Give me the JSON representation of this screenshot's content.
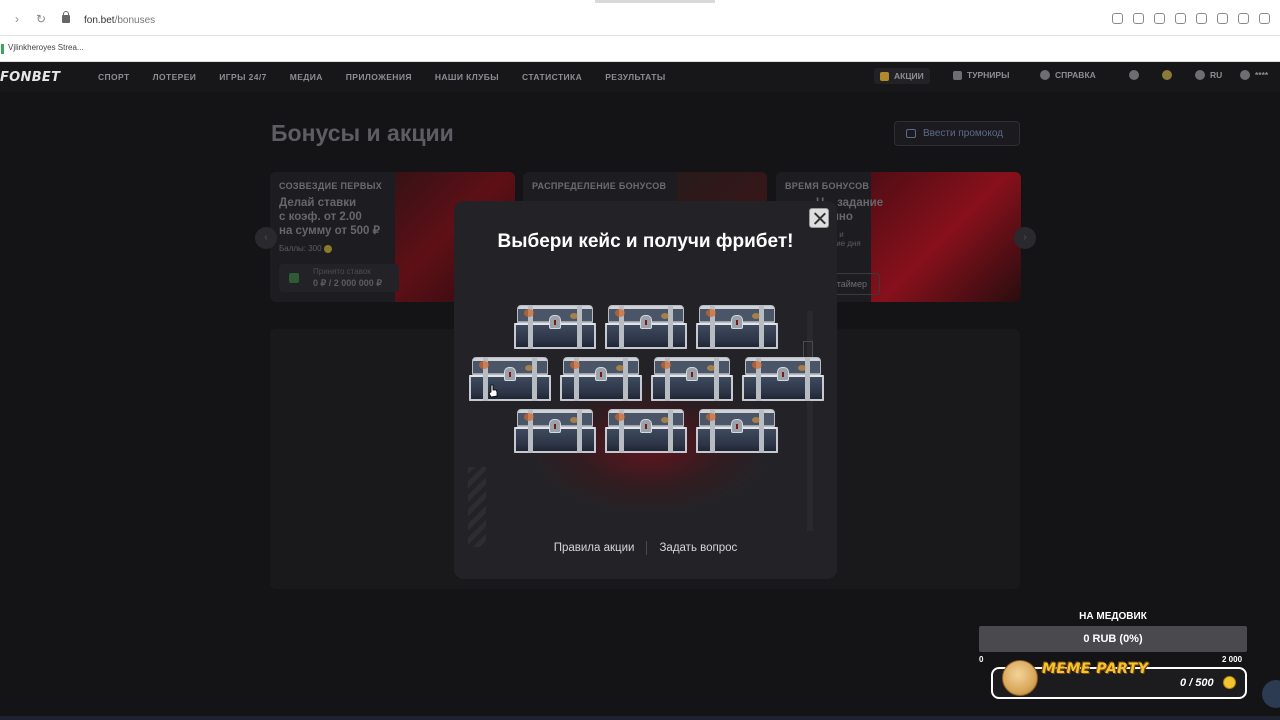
{
  "browser": {
    "url_domain": "fon.bet",
    "url_path": "/bonuses",
    "bookmark": "Vjlinkheroyes Strea..."
  },
  "header": {
    "logo": "FONBET",
    "nav": [
      "СПОРТ",
      "ЛОТЕРЕИ",
      "ИГРЫ 24/7",
      "МЕДИА",
      "ПРИЛОЖЕНИЯ",
      "НАШИ КЛУБЫ",
      "СТАТИСТИКА",
      "РЕЗУЛЬТАТЫ"
    ],
    "promotions": "АКЦИИ",
    "tournaments": "ТУРНИРЫ",
    "help": "СПРАВКА",
    "language": "RU",
    "account": "****"
  },
  "page": {
    "title": "Бонусы и акции",
    "promo_code_button": "Ввести промокод"
  },
  "cards": [
    {
      "label": "СОЗВЕЗДИЕ ПЕРВЫХ",
      "headline": [
        "Делай ставки",
        "с коэф. от 2.00",
        "на сумму от 500 ₽"
      ],
      "points": "Баллы: 300",
      "accepted_label": "Принято ставок",
      "accepted_value": "0 ₽ / 2 000 000 ₽"
    },
    {
      "label": "РАСПРЕДЕЛЕНИЕ БОНУСОВ"
    },
    {
      "label": "ВРЕМЯ БОНУСОВ",
      "headline": [
        "Н... задание",
        "...упно"
      ],
      "sub": [
        "...мер и",
        "...дание дня"
      ],
      "button": "...ть таймер"
    }
  ],
  "modal": {
    "title": "Выбери кейс и получи фрибет!",
    "rules_link": "Правила акции",
    "ask_link": "Задать вопрос",
    "chests_row1": 3,
    "chests_row2": 4,
    "chests_row3": 3
  },
  "widget": {
    "title": "НА МЕДОВИК",
    "bar_text": "0 RUB (0%)",
    "min": "0",
    "max": "2 000",
    "meme_label": "MEME PARTY",
    "meme_count": "0 / 500"
  }
}
